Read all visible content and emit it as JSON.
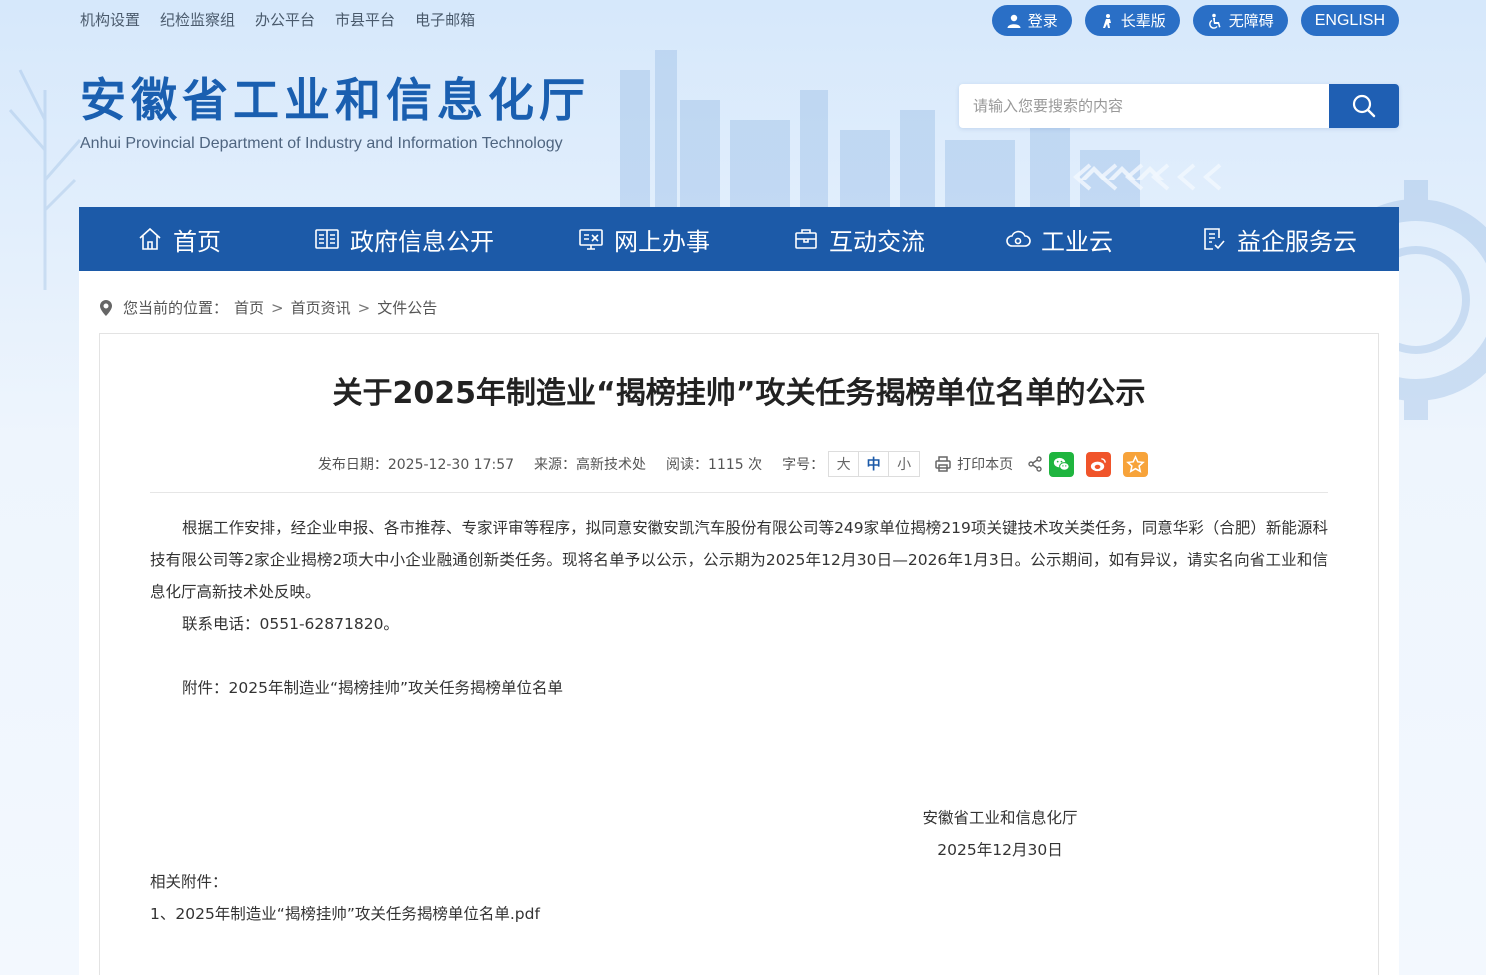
{
  "top_links": [
    "机构设置",
    "纪检监察组",
    "办公平台",
    "市县平台",
    "电子邮箱"
  ],
  "top_buttons": {
    "login": "登录",
    "elder": "长辈版",
    "accessible": "无障碍",
    "english": "ENGLISH"
  },
  "site": {
    "title": "安徽省工业和信息化厅",
    "subtitle": "Anhui Provincial Department of Industry and Information Technology"
  },
  "search": {
    "placeholder": "请输入您要搜索的内容"
  },
  "nav": [
    "首页",
    "政府信息公开",
    "网上办事",
    "互动交流",
    "工业云",
    "益企服务云"
  ],
  "breadcrumb": {
    "label": "您当前的位置：",
    "items": [
      "首页",
      "首页资讯",
      "文件公告"
    ],
    "sep": ">"
  },
  "article": {
    "title": "关于2025年制造业“揭榜挂帅”攻关任务揭榜单位名单的公示",
    "meta": {
      "date": "发布日期：2025-12-30 17:57",
      "source": "来源：高新技术处",
      "views": "阅读：1115 次",
      "font_label": "字号：",
      "font_sizes": [
        "大",
        "中",
        "小"
      ],
      "print": "打印本页"
    },
    "paragraphs": [
      "根据工作安排，经企业申报、各市推荐、专家评审等程序，拟同意安徽安凯汽车股份有限公司等249家单位揭榜219项关键技术攻关类任务，同意华彩（合肥）新能源科技有限公司等2家企业揭榜2项大中小企业融通创新类任务。现将名单予以公示，公示期为2025年12月30日—2026年1月3日。公示期间，如有异议，请实名向省工业和信息化厅高新技术处反映。",
      "联系电话：0551-62871820。",
      "附件：2025年制造业“揭榜挂帅”攻关任务揭榜单位名单"
    ],
    "signature": {
      "org": "安徽省工业和信息化厅",
      "date": "2025年12月30日"
    },
    "attachments": {
      "label": "相关附件：",
      "items": [
        "1、2025年制造业“揭榜挂帅”攻关任务揭榜单位名单.pdf"
      ]
    }
  },
  "colors": {
    "nav_bg": "#1c5aa8",
    "title_blue": "#1a5fb0",
    "pill_bg": "#2a6fc6"
  }
}
